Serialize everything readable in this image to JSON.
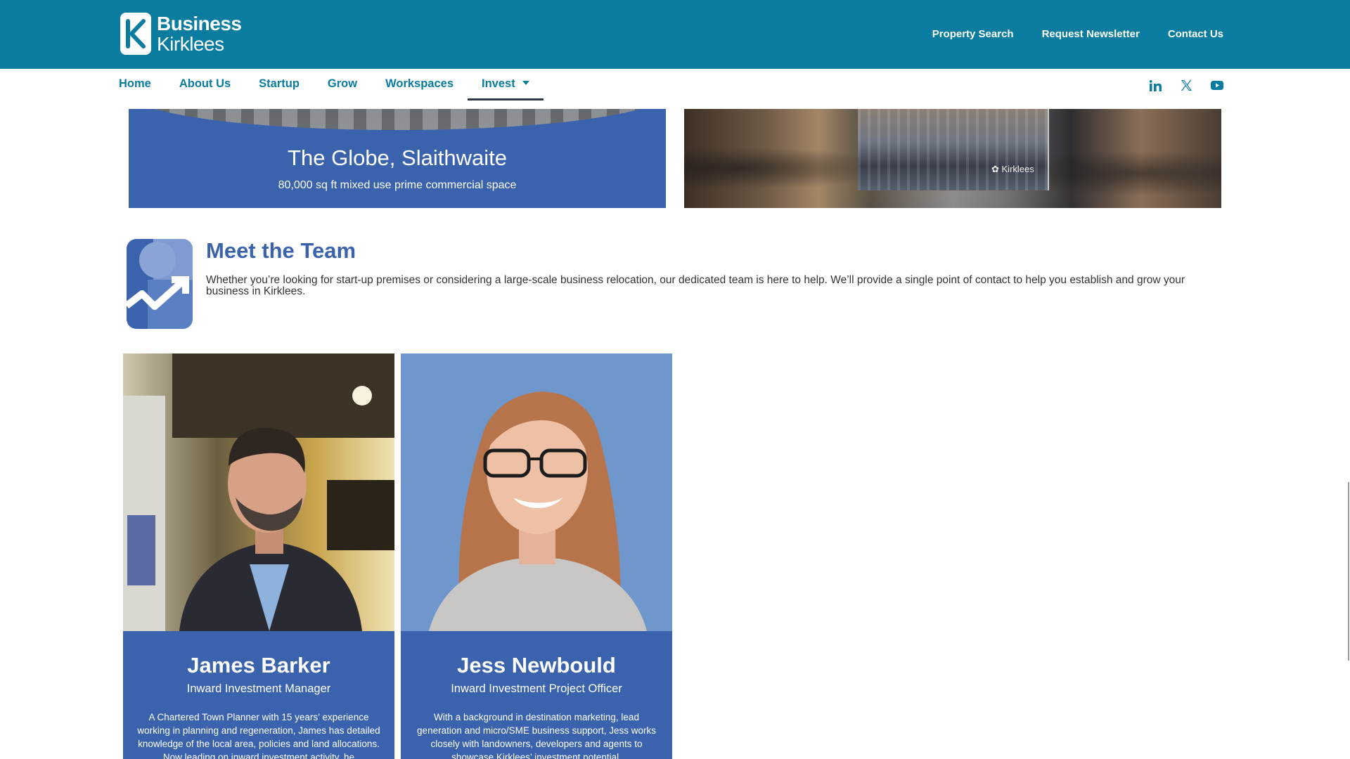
{
  "brand": {
    "name_line1": "Business",
    "name_line2": "Kirklees",
    "header_color": "#0a7ca0",
    "accent_blue": "#3b63ad"
  },
  "top_links": [
    {
      "label": "Property Search"
    },
    {
      "label": "Request Newsletter"
    },
    {
      "label": "Contact Us"
    }
  ],
  "nav": {
    "items": [
      {
        "label": "Home"
      },
      {
        "label": "About Us"
      },
      {
        "label": "Startup"
      },
      {
        "label": "Grow"
      },
      {
        "label": "Workspaces"
      },
      {
        "label": "Invest",
        "active": true,
        "has_dropdown": true
      }
    ],
    "social_icons": [
      "linkedin-icon",
      "x-twitter-icon",
      "youtube-icon"
    ]
  },
  "property_cards": {
    "left": {
      "title": "The Globe, Slaithwaite",
      "subtitle": "80,000 sq ft mixed use prime commercial space"
    },
    "right": {
      "watermark": "Kirklees"
    }
  },
  "team": {
    "title": "Meet the Team",
    "description": "Whether you’re looking for start-up premises or considering a large-scale business relocation, our dedicated team is here to help. We’ll provide a single point of contact to help you establish and grow your business in Kirklees.",
    "members": [
      {
        "name": "James Barker",
        "role": "Inward Investment Manager",
        "bio": "A Chartered Town Planner with 15 years’ experience working in planning and regeneration, James has detailed knowledge of the local area, policies and land allocations. Now leading on inward investment activity, he"
      },
      {
        "name": "Jess Newbould",
        "role": "Inward Investment Project Officer",
        "bio": "With a background in destination marketing, lead generation and micro/SME business support, Jess works closely with landowners, developers and agents to showcase Kirklees’ investment potential."
      }
    ]
  }
}
